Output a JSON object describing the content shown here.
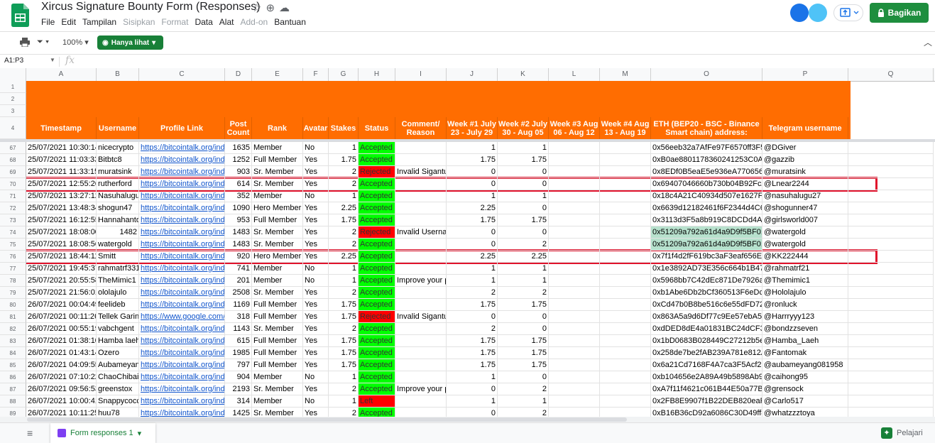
{
  "document": {
    "title": "Xircus Signature Bounty Form  (Responses)",
    "title_icons": [
      "star-icon",
      "move-icon",
      "cloud-status-icon"
    ]
  },
  "menu": [
    "File",
    "Edit",
    "Tampilan",
    "Sisipkan",
    "Format",
    "Data",
    "Alat",
    "Add-on",
    "Bantuan"
  ],
  "menu_dimmed": [
    false,
    false,
    false,
    true,
    true,
    false,
    false,
    true,
    false
  ],
  "share": {
    "label": "Bagikan"
  },
  "toolbar": {
    "zoom": "100%",
    "view_mode": "Hanya lihat"
  },
  "formula_bar": {
    "cell_ref": "A1:P3",
    "fx": "fx"
  },
  "columns": [
    "A",
    "B",
    "C",
    "D",
    "E",
    "F",
    "G",
    "H",
    "I",
    "J",
    "K",
    "L",
    "M",
    "O",
    "P",
    "Q"
  ],
  "header_row_numbers": [
    "1",
    "2",
    "3",
    "4"
  ],
  "headers": [
    "Timestamp",
    "Username",
    "Profile Link",
    "Post Count",
    "Rank",
    "Avatar",
    "Stakes",
    "Status",
    "Comment/ Reason",
    "Week #1 July 23 - July 29",
    "Week #2 July 30 - Aug 05",
    "Week #3 Aug 06 - Aug 12",
    "Week #4 Aug 13 - Aug 19",
    "ETH (BEP20 - BSC - Binance Smart chain) address:",
    "Telegram username"
  ],
  "rows": [
    {
      "n": "67",
      "ts": "25/07/2021 10:30:14",
      "user": "nicecrypto",
      "link": "https://bitcointalk.org/inde",
      "posts": "1635",
      "rank": "Member",
      "avatar": "No",
      "stakes": "1",
      "status": "Accepted",
      "comment": "",
      "w1": "1",
      "w2": "1",
      "eth": "0x56eeb32a7AfFe97F6570ff3F5",
      "tg": "@DGiver"
    },
    {
      "n": "68",
      "ts": "25/07/2021 11:03:33",
      "user": "Bitbtc8",
      "link": "https://bitcointalk.org/inde",
      "posts": "1252",
      "rank": "Full Member",
      "avatar": "Yes",
      "stakes": "1.75",
      "status": "Accepted",
      "comment": "",
      "w1": "1.75",
      "w2": "1.75",
      "eth": "0xB0ae8801178360241253C0Ac",
      "tg": "@gazzib"
    },
    {
      "n": "69",
      "ts": "25/07/2021 11:33:15",
      "user": "muratsink",
      "link": "https://bitcointalk.org/inde",
      "posts": "903",
      "rank": "Sr. Member",
      "avatar": "Yes",
      "stakes": "2",
      "status": "Rejected",
      "comment": "Invalid Sigantu",
      "w1": "0",
      "w2": "0",
      "eth": "0x8EDf0B5eaE5e936eA7706565",
      "tg": "@muratsink"
    },
    {
      "n": "70",
      "ts": "25/07/2021 12:55:26",
      "user": "rutherford",
      "link": "https://bitcointalk.org/inde",
      "posts": "614",
      "rank": "Sr. Member",
      "avatar": "Yes",
      "stakes": "2",
      "status": "Accepted",
      "comment": "",
      "w1": "0",
      "w2": "0",
      "eth": "0x69407046660b730b04B92FcA",
      "tg": "@Lnear2244"
    },
    {
      "n": "71",
      "ts": "25/07/2021 13:27:12",
      "user": "Nasuhalugu",
      "link": "https://bitcointalk.org/inde",
      "posts": "352",
      "rank": "Member",
      "avatar": "No",
      "stakes": "1",
      "status": "Accepted",
      "comment": "",
      "w1": "1",
      "w2": "1",
      "eth": "0x18c4A21C40934d507e1627F5",
      "tg": "@nasuhalugu27"
    },
    {
      "n": "72",
      "ts": "25/07/2021 13:48:34",
      "user": "shogun47",
      "link": "https://bitcointalk.org/inde",
      "posts": "1090",
      "rank": "Hero Member",
      "avatar": "Yes",
      "stakes": "2.25",
      "status": "Accepted",
      "comment": "",
      "w1": "2.25",
      "w2": "0",
      "eth": "0x6639d12182461f6F2344d4C62",
      "tg": "@shogunner47"
    },
    {
      "n": "73",
      "ts": "25/07/2021 16:12:55",
      "user": "Hannahanto",
      "link": "https://bitcointalk.org/inde",
      "posts": "953",
      "rank": "Full Member",
      "avatar": "Yes",
      "stakes": "1.75",
      "status": "Accepted",
      "comment": "",
      "w1": "1.75",
      "w2": "1.75",
      "eth": "0x3113d3F5a8b919C8DCDd4A9",
      "tg": "@girlsworld007"
    },
    {
      "n": "74",
      "ts": "25/07/2021 18:08:00",
      "user": "1482",
      "link": "https://bitcointalk.org/inde",
      "posts": "1483",
      "rank": "Sr. Member",
      "avatar": "Yes",
      "stakes": "2",
      "status": "Rejected",
      "comment": "Invalid Userna",
      "w1": "0",
      "w2": "0",
      "eth": "0x51209a792a61d4a9D9f5BF01",
      "tg": "@watergold"
    },
    {
      "n": "75",
      "ts": "25/07/2021 18:08:56",
      "user": "watergold",
      "link": "https://bitcointalk.org/inde",
      "posts": "1483",
      "rank": "Sr. Member",
      "avatar": "Yes",
      "stakes": "2",
      "status": "Accepted",
      "comment": "",
      "w1": "0",
      "w2": "2",
      "eth": "0x51209a792a61d4a9D9f5BF01",
      "tg": "@watergold"
    },
    {
      "n": "76",
      "ts": "25/07/2021 18:44:11",
      "user": "Smitt",
      "link": "https://bitcointalk.org/inde",
      "posts": "920",
      "rank": "Hero Member",
      "avatar": "Yes",
      "stakes": "2.25",
      "status": "Accepted",
      "comment": "",
      "w1": "2.25",
      "w2": "2.25",
      "eth": "0x7f1f4d2fF619bc3aF3eaf656E6",
      "tg": "@KK222444"
    },
    {
      "n": "77",
      "ts": "25/07/2021 19:45:37",
      "user": "rahmatrf331",
      "link": "https://bitcointalk.org/inde",
      "posts": "741",
      "rank": "Member",
      "avatar": "No",
      "stakes": "1",
      "status": "Accepted",
      "comment": "",
      "w1": "1",
      "w2": "1",
      "eth": "0x1e3892AD73E356c664b1B47e",
      "tg": "@rahmatrf21"
    },
    {
      "n": "78",
      "ts": "25/07/2021 20:55:58",
      "user": "TheMimic1",
      "link": "https://bitcointalk.org/inde",
      "posts": "201",
      "rank": "Member",
      "avatar": "No",
      "stakes": "1",
      "status": "Accepted",
      "comment": "Improve your p",
      "w1": "1",
      "w2": "1",
      "eth": "0x5968bb7C42dEc871De7926a8",
      "tg": "@Themimic1"
    },
    {
      "n": "79",
      "ts": "25/07/2021 21:56:01",
      "user": "ololajulo",
      "link": "https://bitcointalk.org/inde",
      "posts": "2508",
      "rank": "Sr. Member",
      "avatar": "Yes",
      "stakes": "2",
      "status": "Accepted",
      "comment": "",
      "w1": "2",
      "w2": "2",
      "eth": "0xb1Abe6Db2bCf360513F6eDcE",
      "tg": "@Hololajulo"
    },
    {
      "n": "80",
      "ts": "26/07/2021 00:04:49",
      "user": "feelideb",
      "link": "https://bitcointalk.org/inde",
      "posts": "1169",
      "rank": "Full Member",
      "avatar": "Yes",
      "stakes": "1.75",
      "status": "Accepted",
      "comment": "",
      "w1": "1.75",
      "w2": "1.75",
      "eth": "0xCd47b0B8be516c6e55dFD72E",
      "tg": "@ronluck"
    },
    {
      "n": "81",
      "ts": "26/07/2021 00:11:26",
      "user": "Tellek Garin",
      "link": "https://www.google.com/",
      "posts": "318",
      "rank": "Full Member",
      "avatar": "Yes",
      "stakes": "1.75",
      "status": "Rejected",
      "comment": "Invalid Sigantu",
      "w1": "0",
      "w2": "0",
      "eth": "0x863A5a9d6Df77c9Ee57ebA56",
      "tg": "@Harrryyy123"
    },
    {
      "n": "82",
      "ts": "26/07/2021 00:55:19",
      "user": "vabchgent",
      "link": "https://bitcointalk.org/inde",
      "posts": "1143",
      "rank": "Sr. Member",
      "avatar": "Yes",
      "stakes": "2",
      "status": "Accepted",
      "comment": "",
      "w1": "2",
      "w2": "0",
      "eth": "0xdDED8dE4a01831BC24dCF3C",
      "tg": "@bondzzseven"
    },
    {
      "n": "83",
      "ts": "26/07/2021 01:38:10",
      "user": "Hamba laeh",
      "link": " https://bitcointalk.org/ind",
      "posts": "615",
      "rank": "Full Member",
      "avatar": "Yes",
      "stakes": "1.75",
      "status": "Accepted",
      "comment": "",
      "w1": "1.75",
      "w2": "1.75",
      "eth": "0x1bD0683B028449C27212b5e6",
      "tg": "@Hamba_Laeh"
    },
    {
      "n": "84",
      "ts": "26/07/2021 01:43:14",
      "user": "Ozero",
      "link": "https://bitcointalk.org/inde",
      "posts": "1985",
      "rank": "Full Member",
      "avatar": "Yes",
      "stakes": "1.75",
      "status": "Accepted",
      "comment": "",
      "w1": "1.75",
      "w2": "1.75",
      "eth": "0x258de7be2fAB239A781e812A",
      "tg": "@Fantomak"
    },
    {
      "n": "85",
      "ts": "26/07/2021 04:09:55",
      "user": "Aubameyan",
      "link": "https://bitcointalk.org/inde",
      "posts": "797",
      "rank": "Full Member",
      "avatar": "Yes",
      "stakes": "1.75",
      "status": "Accepted",
      "comment": "",
      "w1": "1.75",
      "w2": "1.75",
      "eth": "0x6a21Cd7168F4A7ca3F5Acf27",
      "tg": "@aubameyang081958"
    },
    {
      "n": "86",
      "ts": "26/07/2021 07:10:22",
      "user": "ChaoChibai",
      "link": "https://bitcointalk.org/inde",
      "posts": "904",
      "rank": "Member",
      "avatar": "No",
      "stakes": "1",
      "status": "Accepted",
      "comment": "",
      "w1": "1",
      "w2": "0",
      "eth": "0xb104656e2A89A49b5898Ab95",
      "tg": "@caihong95"
    },
    {
      "n": "87",
      "ts": "26/07/2021 09:56:53",
      "user": "greenstox",
      "link": "https://bitcointalk.org/inde",
      "posts": "2193",
      "rank": "Sr. Member",
      "avatar": "Yes",
      "stakes": "2",
      "status": "Accepted",
      "comment": "Improve your p",
      "w1": "0",
      "w2": "2",
      "eth": "0xA7f11f4621c061B44E50a77Bd",
      "tg": "@grensock"
    },
    {
      "n": "88",
      "ts": "26/07/2021 10:00:41",
      "user": "Snappycocc",
      "link": "https://bitcointalk.org/inde",
      "posts": "314",
      "rank": "Member",
      "avatar": "No",
      "stakes": "1",
      "status": "Left",
      "comment": "",
      "w1": "1",
      "w2": "1",
      "eth": "0x2FB8E9907f1B22DEB820eaF5",
      "tg": "@Carlo517"
    },
    {
      "n": "89",
      "ts": "26/07/2021 10:11:25",
      "user": "huu78",
      "link": "https://bitcointalk.org/inde",
      "posts": "1425",
      "rank": "Sr. Member",
      "avatar": "Yes",
      "stakes": "2",
      "status": "Accepted",
      "comment": "",
      "w1": "0",
      "w2": "2",
      "eth": "0xB16B36cD92a6086C30D49ff8",
      "tg": "@whatzzztoya"
    }
  ],
  "highlighted_rows": [
    "70",
    "76"
  ],
  "sheet_tab": {
    "label": "Form responses 1"
  },
  "explore": {
    "label": "Pelajari"
  },
  "colors": {
    "header_orange": "#ff6d01",
    "accepted": "#00ff00",
    "rejected": "#ff0000",
    "share_green": "#1e8e3e",
    "highlight_red": "#e0132c"
  }
}
